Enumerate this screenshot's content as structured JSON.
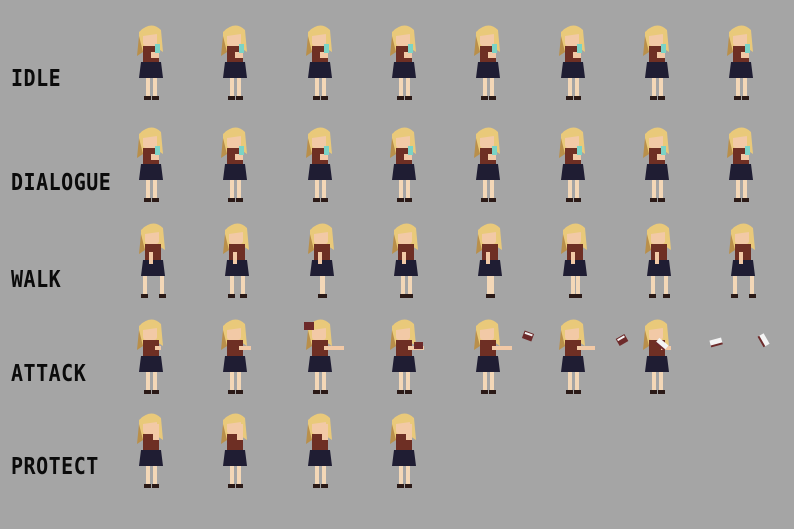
{
  "sprite_sheet": {
    "background": "#a5a5a5",
    "colors": {
      "hair": "#e9c97a",
      "hair_shadow": "#b98f4a",
      "skin": "#f2c9a6",
      "top": "#6e2f24",
      "skirt": "#1f1d33",
      "legs": "#f3d7b7",
      "shoes": "#2b1a17",
      "drink": "#7bd3c6",
      "book": "#6d2a2a",
      "paper": "#f4f4f4"
    },
    "rows": [
      {
        "label": "IDLE",
        "frames": 8
      },
      {
        "label": "DIALOGUE",
        "frames": 8
      },
      {
        "label": "WALK",
        "frames": 8
      },
      {
        "label": "ATTACK",
        "frames": 7
      },
      {
        "label": "PROTECT",
        "frames": 4
      }
    ]
  }
}
